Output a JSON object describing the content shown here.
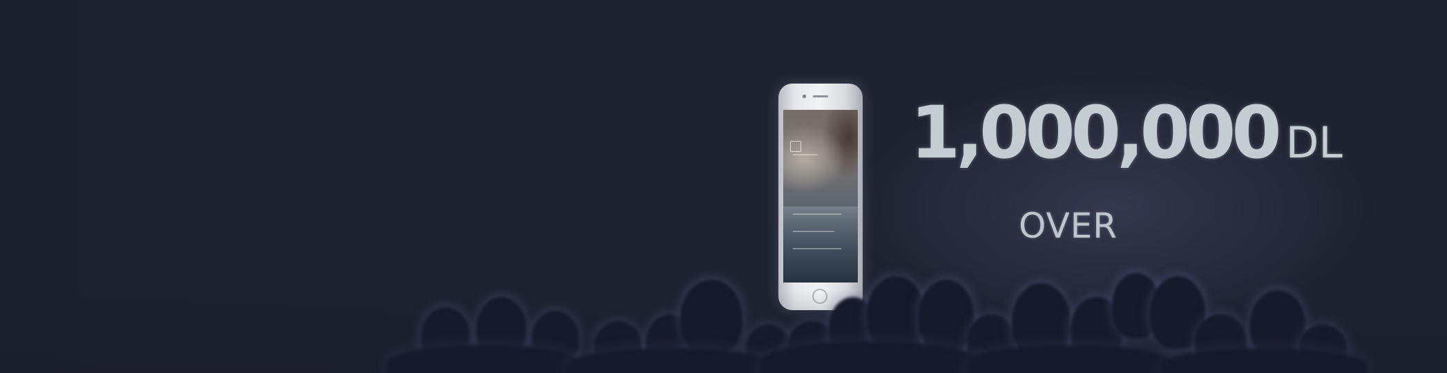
{
  "slide": {
    "number": "1,000,000",
    "unit": "DL",
    "label": "OVER"
  },
  "colors": {
    "background": "#1f2331",
    "slide_text": "#c3cdd2",
    "silhouette": "#16192a"
  },
  "icons": {
    "phone": "smartphone-icon"
  }
}
